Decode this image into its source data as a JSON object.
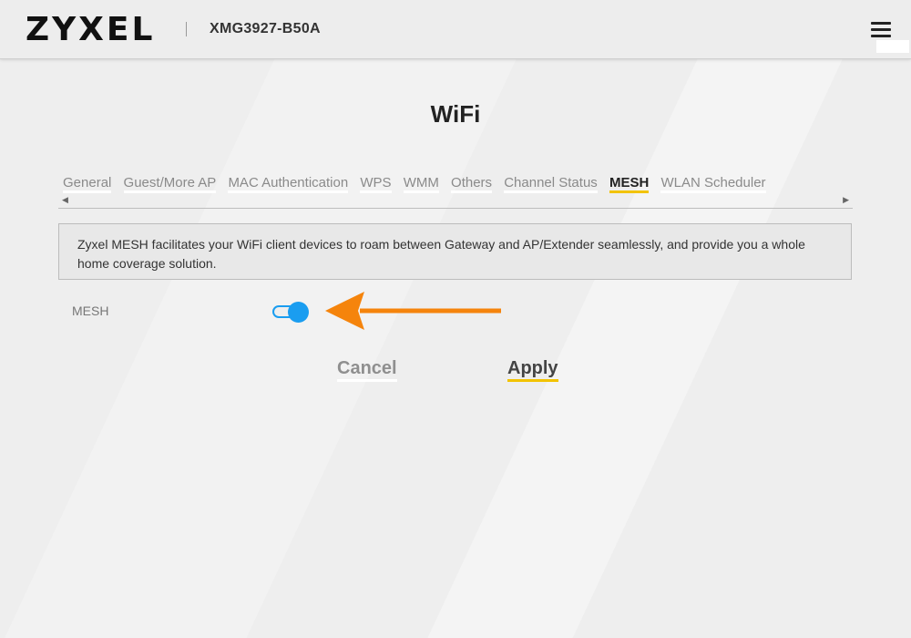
{
  "header": {
    "logo": "ZYXEL",
    "model": "XMG3927-B50A"
  },
  "page": {
    "title": "WiFi"
  },
  "tabs": [
    {
      "label": "General",
      "active": false
    },
    {
      "label": "Guest/More AP",
      "active": false
    },
    {
      "label": "MAC Authentication",
      "active": false
    },
    {
      "label": "WPS",
      "active": false
    },
    {
      "label": "WMM",
      "active": false
    },
    {
      "label": "Others",
      "active": false
    },
    {
      "label": "Channel Status",
      "active": false
    },
    {
      "label": "MESH",
      "active": true
    },
    {
      "label": "WLAN Scheduler",
      "active": false
    }
  ],
  "info": {
    "text": "Zyxel MESH facilitates your WiFi client devices to roam between Gateway and AP/Extender seamlessly, and provide you a whole home coverage solution."
  },
  "mesh": {
    "label": "MESH",
    "enabled": true
  },
  "buttons": {
    "cancel": "Cancel",
    "apply": "Apply"
  },
  "colors": {
    "accent_yellow": "#f2c300",
    "toggle_blue": "#1a9df0",
    "arrow_orange": "#f5840c"
  },
  "icons": {
    "menu": "hamburger-menu-icon",
    "scroll_left": "chevron-left-icon",
    "scroll_right": "chevron-right-icon",
    "annotation": "arrow-left-icon"
  }
}
